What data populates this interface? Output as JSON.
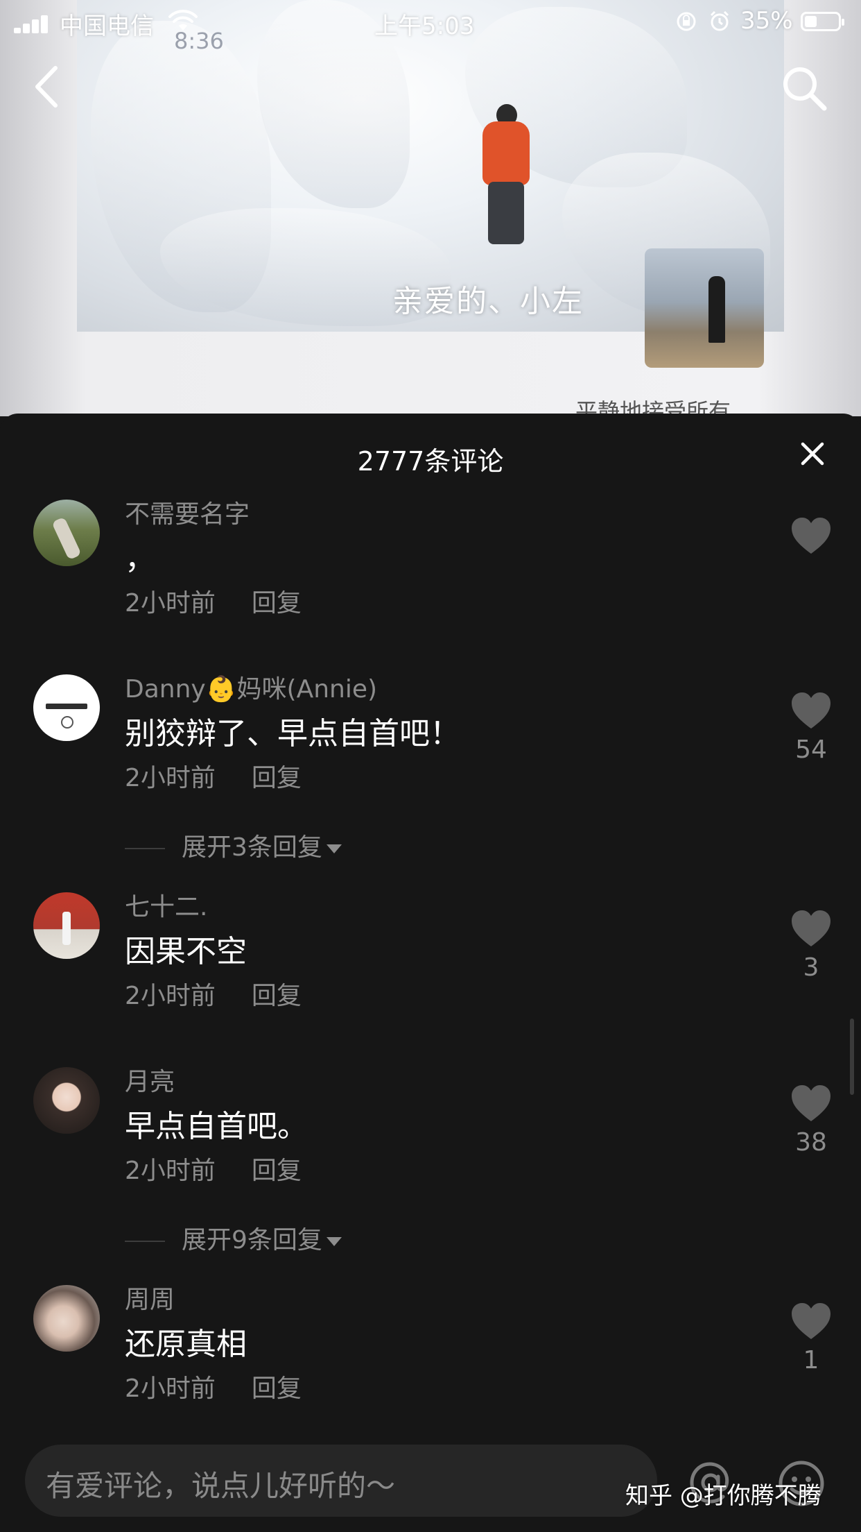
{
  "status_bar": {
    "carrier": "中国电信",
    "time": "上午5:03",
    "battery": "35%"
  },
  "video": {
    "caption": "亲爱的、小左",
    "timestamp": "8:36",
    "under_text": "平静地接受所有"
  },
  "comments_panel": {
    "title": "2777条评论",
    "comments": [
      {
        "username": "不需要名字",
        "text": "，",
        "time": "2小时前",
        "reply_label": "回复",
        "likes": ""
      },
      {
        "username": "Danny👶妈咪(Annie)",
        "text": "别狡辩了、早点自首吧！",
        "time": "2小时前",
        "reply_label": "回复",
        "likes": "54",
        "expand": "展开3条回复"
      },
      {
        "username": "七十二.",
        "text": "因果不空",
        "time": "2小时前",
        "reply_label": "回复",
        "likes": "3"
      },
      {
        "username": "月亮",
        "text": "早点自首吧。",
        "time": "2小时前",
        "reply_label": "回复",
        "likes": "38",
        "expand": "展开9条回复"
      },
      {
        "username": "周周",
        "text": "还原真相",
        "time": "2小时前",
        "reply_label": "回复",
        "likes": "1"
      }
    ]
  },
  "input": {
    "placeholder": "有爱评论，说点儿好听的～"
  },
  "watermark": "知乎 @打你腾不腾",
  "colors": {
    "panel_bg": "#161616",
    "secondary_text": "#8d8d8d",
    "primary_text": "#ffffff",
    "input_bg": "#262626"
  }
}
